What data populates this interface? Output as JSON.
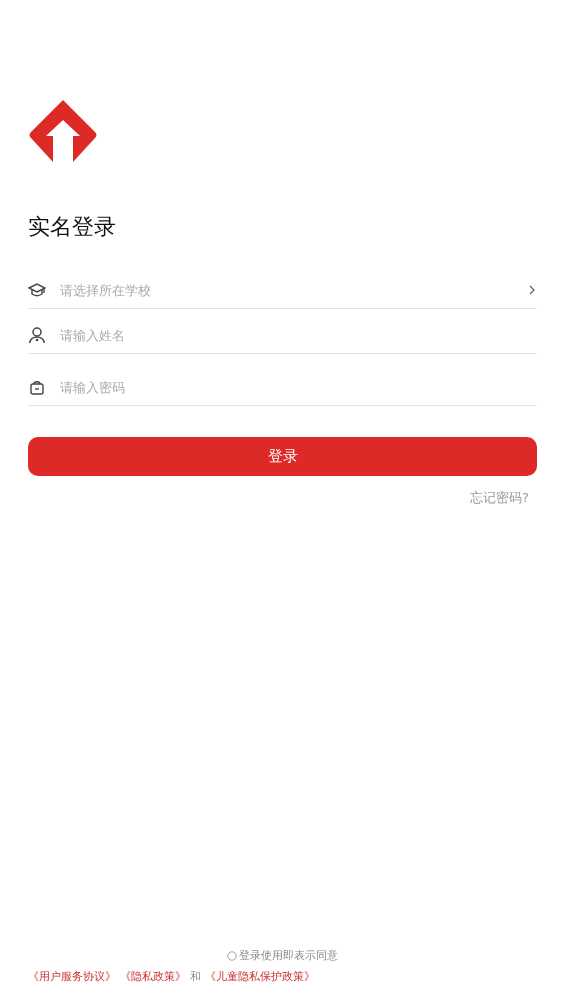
{
  "title": "实名登录",
  "fields": [
    {
      "kind": "select",
      "placeholder": "请选择所在学校"
    },
    {
      "kind": "text",
      "placeholder": "请输入姓名"
    },
    {
      "kind": "password",
      "placeholder": "请输入密码"
    }
  ],
  "login_button": "登录",
  "forgot_link": "忘记密码?",
  "agreement": {
    "checked": false,
    "text": "登录使用即表示同意",
    "links": [
      {
        "kind": "link",
        "text": "《用户服务协议》"
      },
      {
        "kind": "link",
        "text": "《隐私政策》"
      },
      {
        "kind": "plain",
        "text": "和"
      },
      {
        "kind": "link",
        "text": "《儿童隐私保护政策》"
      }
    ]
  }
}
